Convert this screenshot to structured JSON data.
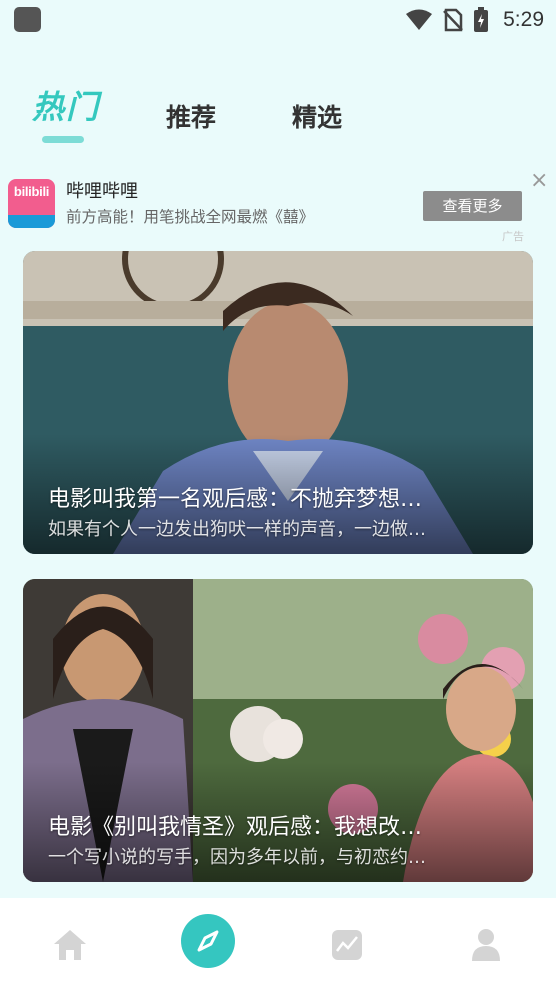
{
  "status_bar": {
    "time": "5:29",
    "icons": [
      "wifi-icon",
      "no-sim-icon",
      "battery-icon"
    ]
  },
  "tabs": [
    {
      "label": "热门",
      "active": true
    },
    {
      "label": "推荐",
      "active": false
    },
    {
      "label": "精选",
      "active": false
    }
  ],
  "ad": {
    "logo_text": "bilibili",
    "title": "哔哩哔哩",
    "description": "前方高能！用笔挑战全网最燃《囍》",
    "button_label": "查看更多",
    "close_symbol": "×",
    "badge": "广告"
  },
  "articles": [
    {
      "title": "电影叫我第一名观后感：不抛弃梦想…",
      "description": "如果有个人一边发出狗吠一样的声音，一边做…"
    },
    {
      "title": "电影《别叫我情圣》观后感：我想改…",
      "description": "一个写小说的写手，因为多年以前，与初恋约…"
    }
  ],
  "bottom_nav": [
    {
      "icon": "home-icon",
      "active": false
    },
    {
      "icon": "compass-icon",
      "active": true
    },
    {
      "icon": "chart-icon",
      "active": false
    },
    {
      "icon": "user-icon",
      "active": false
    }
  ],
  "colors": {
    "accent": "#35c6c0",
    "background": "#eafbfb",
    "inactive_icon": "#d4d4d4"
  }
}
